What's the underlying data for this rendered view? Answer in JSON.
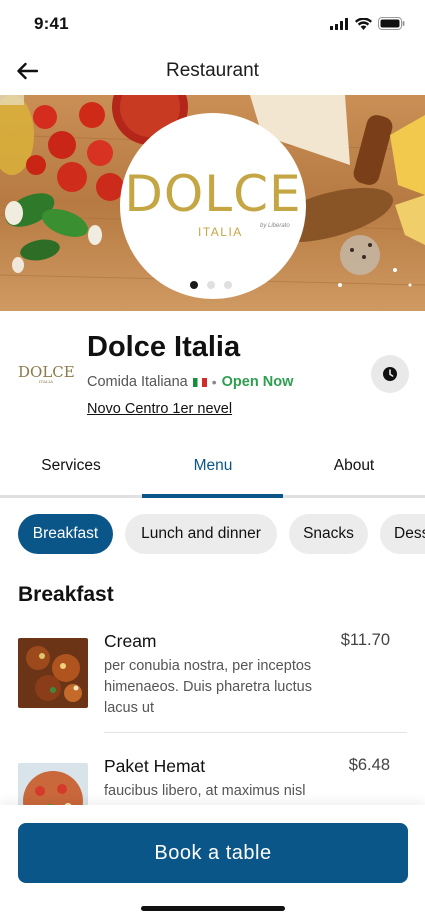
{
  "status_bar": {
    "time": "9:41"
  },
  "header": {
    "title": "Restaurant"
  },
  "hero": {
    "logo_main": "DOLCE",
    "logo_sub": "ITALIA",
    "logo_by": "by Liberato",
    "carousel_dots": 3,
    "active_dot": 1
  },
  "restaurant": {
    "mini_logo": "DOLCE",
    "mini_logo_sub": "ITALIA",
    "name": "Dolce Italia",
    "cuisine": "Comida Italiana",
    "status": "Open Now",
    "location": "Novo Centro 1er nevel"
  },
  "tabs": [
    {
      "label": "Services"
    },
    {
      "label": "Menu",
      "active": true
    },
    {
      "label": "About"
    }
  ],
  "categories": [
    {
      "label": "Breakfast",
      "active": true
    },
    {
      "label": "Lunch and dinner"
    },
    {
      "label": "Snacks"
    },
    {
      "label": "Dess"
    }
  ],
  "menu": {
    "section_title": "Breakfast",
    "items": [
      {
        "name": "Cream",
        "price": "$11.70",
        "description": "per conubia nostra, per inceptos himenaeos. Duis pharetra luctus lacus ut"
      },
      {
        "name": "Paket Hemat",
        "price": "$6.48",
        "description": "faucibus libero, at maximus nisl"
      }
    ]
  },
  "cta": {
    "book_label": "Book a table"
  },
  "colors": {
    "primary": "#0a5689",
    "open_status": "#2e9e4f",
    "logo_gold": "#c5a645",
    "chip_bg": "#ececec"
  },
  "icons": {
    "back": "arrow-left-icon",
    "clock": "clock-icon",
    "signal": "signal-icon",
    "wifi": "wifi-icon",
    "battery": "battery-icon"
  }
}
